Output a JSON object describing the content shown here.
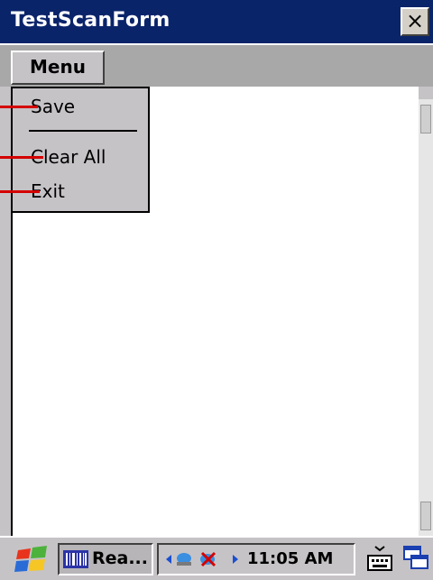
{
  "window": {
    "title": "TestScanForm",
    "close_label": "×"
  },
  "menubar": {
    "menu_label": "Menu"
  },
  "dropdown": {
    "items": [
      "Save",
      "Clear All",
      "Exit"
    ]
  },
  "taskbar": {
    "task_label": "Rea...",
    "clock": "11:05 AM",
    "icons": [
      "windows-start-icon",
      "barcode-app-icon",
      "network-icon",
      "keyboard-icon",
      "window-switch-icon"
    ]
  },
  "colors": {
    "titlebar": "#0a246a",
    "leader": "#d40000"
  }
}
